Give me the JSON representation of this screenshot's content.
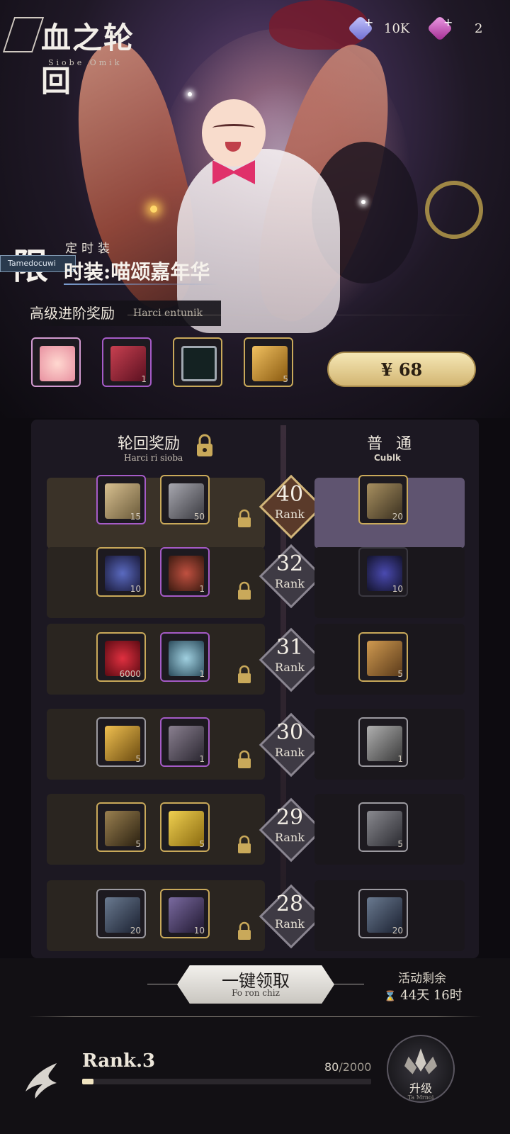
{
  "logo": {
    "title": "血之轮回",
    "subtitle": "Siobe Omik"
  },
  "currencies": [
    {
      "name": "crystal-blue",
      "value": "10K",
      "color": "#8a8ae6"
    },
    {
      "name": "crystal-pink",
      "value": "2",
      "color": "#d04ac0"
    }
  ],
  "outfit": {
    "limited_char": "限",
    "limited_badge": "Tamedocuwi",
    "timed_label": "定时装",
    "name": "时装:喵颂嘉年华"
  },
  "advanced": {
    "title": "高级进阶奖励",
    "subtitle": "Harci entunik"
  },
  "preview_items": [
    {
      "name": "avatar-reward",
      "count": "",
      "color": "#f0b0b8"
    },
    {
      "name": "red-book",
      "count": "1",
      "color": "#9a2a3a"
    },
    {
      "name": "frame-reward",
      "count": "",
      "color": "#2a3a3a"
    },
    {
      "name": "golden-scroll",
      "count": "5",
      "color": "#c88a30"
    }
  ],
  "purchase": {
    "price": "¥ 68"
  },
  "columns": {
    "left": {
      "title": "轮回奖励",
      "subtitle": "Harci ri sioba"
    },
    "right": {
      "title": "普 通",
      "subtitle": "Cublk"
    }
  },
  "rank_word": "Rank",
  "rows": [
    {
      "rank": "40",
      "left": [
        {
          "count": "15",
          "color": "#8a7a55"
        },
        {
          "count": "50",
          "color": "#6a6a70"
        }
      ],
      "right": {
        "count": "20",
        "color": "#6a5a3a"
      }
    },
    {
      "rank": "32",
      "left": [
        {
          "count": "10",
          "color": "#3a3a7a"
        },
        {
          "count": "1",
          "color": "#8a3a2a"
        }
      ],
      "right": {
        "count": "10",
        "color": "#3a3a6a"
      }
    },
    {
      "rank": "31",
      "left": [
        {
          "count": "6000",
          "color": "#9a1a2a"
        },
        {
          "count": "1",
          "color": "#5a8a9a"
        }
      ],
      "right": {
        "count": "5",
        "color": "#8a6a3a"
      }
    },
    {
      "rank": "30",
      "left": [
        {
          "count": "5",
          "color": "#8a6a20"
        },
        {
          "count": "1",
          "color": "#5a5560"
        }
      ],
      "right": {
        "count": "1",
        "color": "#6a6a6a"
      }
    },
    {
      "rank": "29",
      "left": [
        {
          "count": "5",
          "color": "#5a4a30"
        },
        {
          "count": "5",
          "color": "#c8a030"
        }
      ],
      "right": {
        "count": "5",
        "color": "#4a4a50"
      }
    },
    {
      "rank": "28",
      "left": [
        {
          "count": "20",
          "color": "#3a4a5a"
        },
        {
          "count": "10",
          "color": "#4a3a6a"
        }
      ],
      "right": {
        "count": "20",
        "color": "#3a4a5a"
      }
    }
  ],
  "claim": {
    "title": "一键领取",
    "subtitle": "Fo ron chiz"
  },
  "remaining": {
    "label": "活动剩余",
    "value": "44天 16时"
  },
  "player": {
    "rank_label": "Rank.3",
    "exp_current": "80",
    "exp_max": "/2000",
    "progress": 0.04
  },
  "upgrade": {
    "label": "升级",
    "subtitle": "Ta Mrnoi"
  }
}
